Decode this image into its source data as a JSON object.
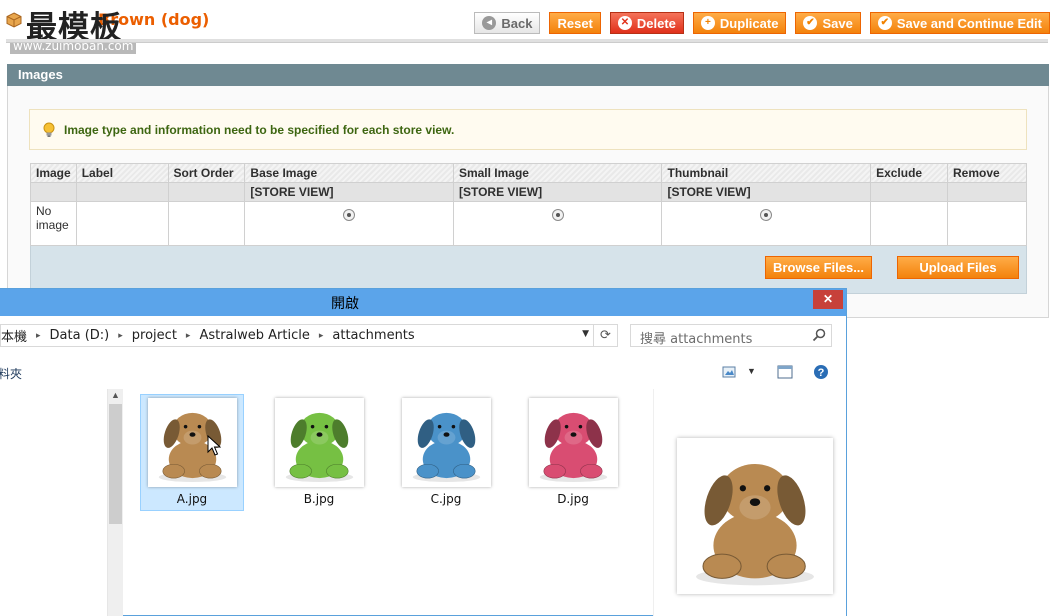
{
  "page": {
    "title": "Brown (dog)",
    "watermark": "最模板",
    "watermark_url": "www.zuimoban.com"
  },
  "toolbar": {
    "back": "Back",
    "reset": "Reset",
    "delete": "Delete",
    "duplicate": "Duplicate",
    "save": "Save",
    "save_continue": "Save and Continue Edit"
  },
  "images_section": {
    "title": "Images",
    "notice": "Image type and information need to be specified for each store view.",
    "columns": [
      "Image",
      "Label",
      "Sort Order",
      "Base Image",
      "Small Image",
      "Thumbnail",
      "Exclude",
      "Remove"
    ],
    "scope_label": "[STORE VIEW]",
    "row": {
      "image": "No image"
    },
    "browse_button": "Browse Files...",
    "upload_button": "Upload Files"
  },
  "dialog": {
    "title": "開啟",
    "close": "✕",
    "breadcrumb": [
      "本機",
      "Data (D:)",
      "project",
      "Astralweb Article",
      "attachments"
    ],
    "search_placeholder": "搜尋 attachments",
    "toolbar_left": "料夾",
    "files": [
      {
        "name": "A.jpg",
        "color": "#b98a52",
        "selected": true
      },
      {
        "name": "B.jpg",
        "color": "#76c043",
        "selected": false
      },
      {
        "name": "C.jpg",
        "color": "#4a92c9",
        "selected": false
      },
      {
        "name": "D.jpg",
        "color": "#d94d72",
        "selected": false
      }
    ],
    "preview_color": "#b98a52"
  },
  "colors": {
    "accent": "#f18200",
    "section_header": "#6f8992",
    "title_orange": "#eb5e00",
    "dialog_title_bar": "#5ba4ea",
    "dialog_close": "#c7413a"
  }
}
